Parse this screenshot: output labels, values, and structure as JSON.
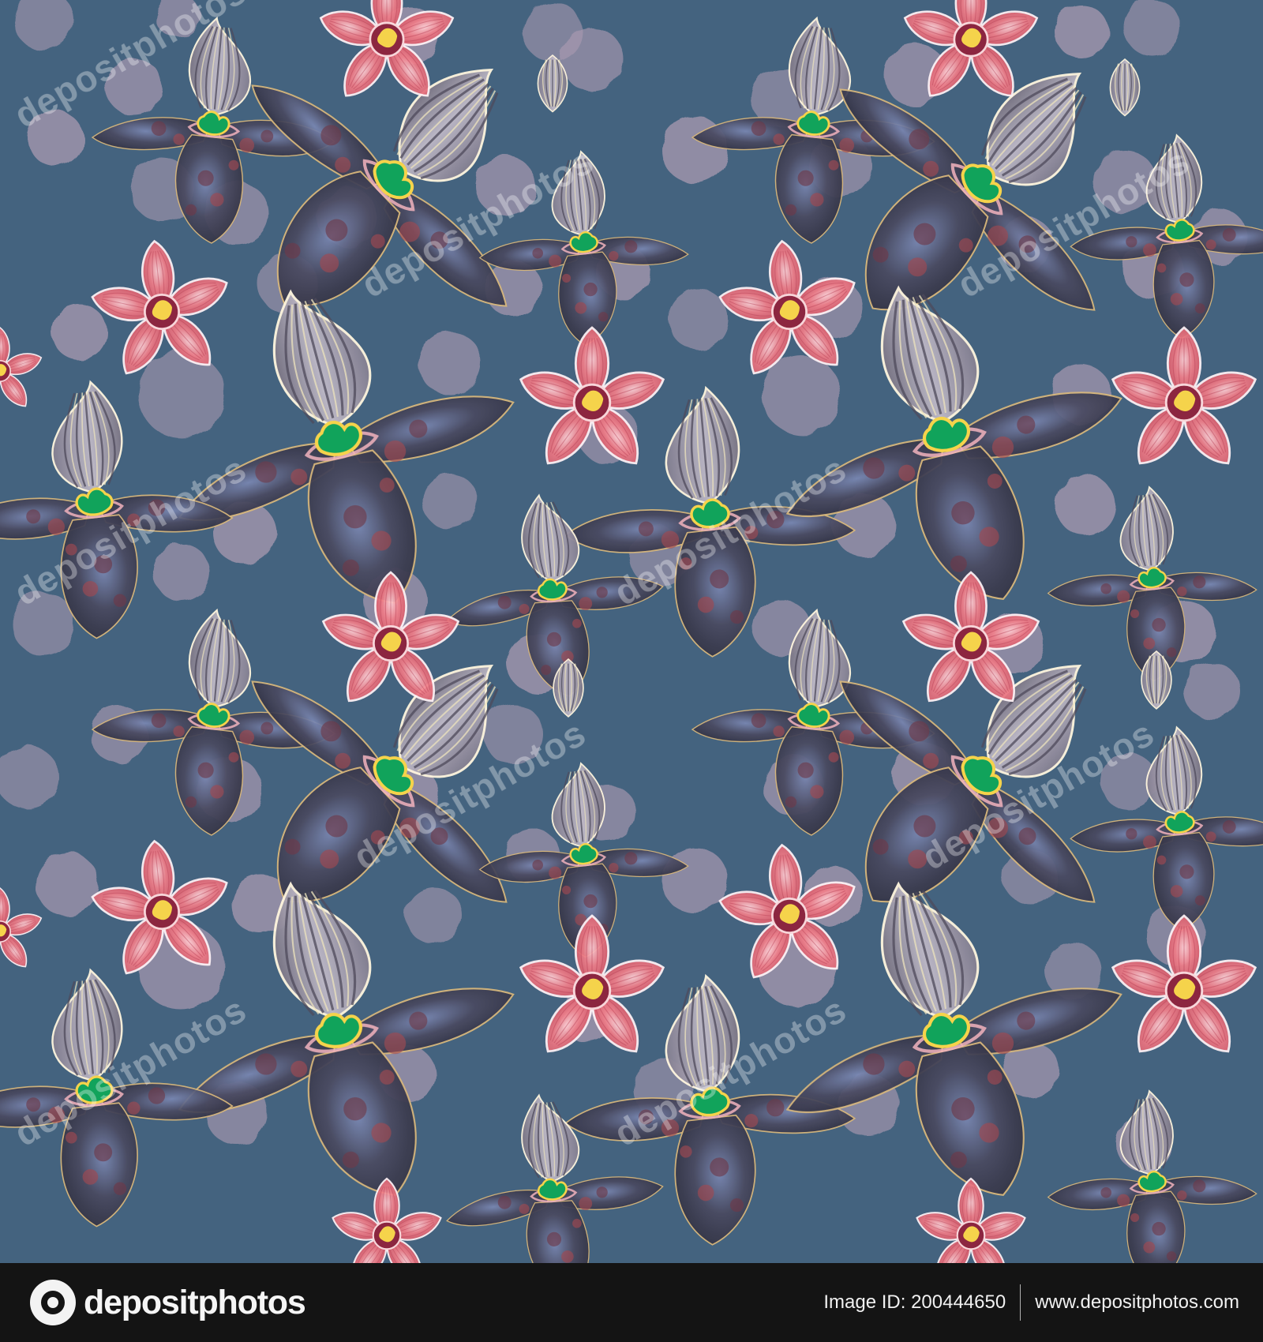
{
  "artwork": {
    "description_name": "watercolor orchid seamless pattern",
    "background_color": "#44637f",
    "accent_colors": {
      "pink_orchid": "#e86c79",
      "dark_orchid": "#4f4c61",
      "striped_petal": "#a8a2b4",
      "soft_dot": "#ad9bb2",
      "center_green": "#11a35b",
      "center_yellow": "#f5d34b"
    },
    "watermark_text": "depositphotos"
  },
  "footer": {
    "brand_name": "depositphotos",
    "image_id_label": "Image ID: 200444650",
    "website": "www.depositphotos.com"
  }
}
